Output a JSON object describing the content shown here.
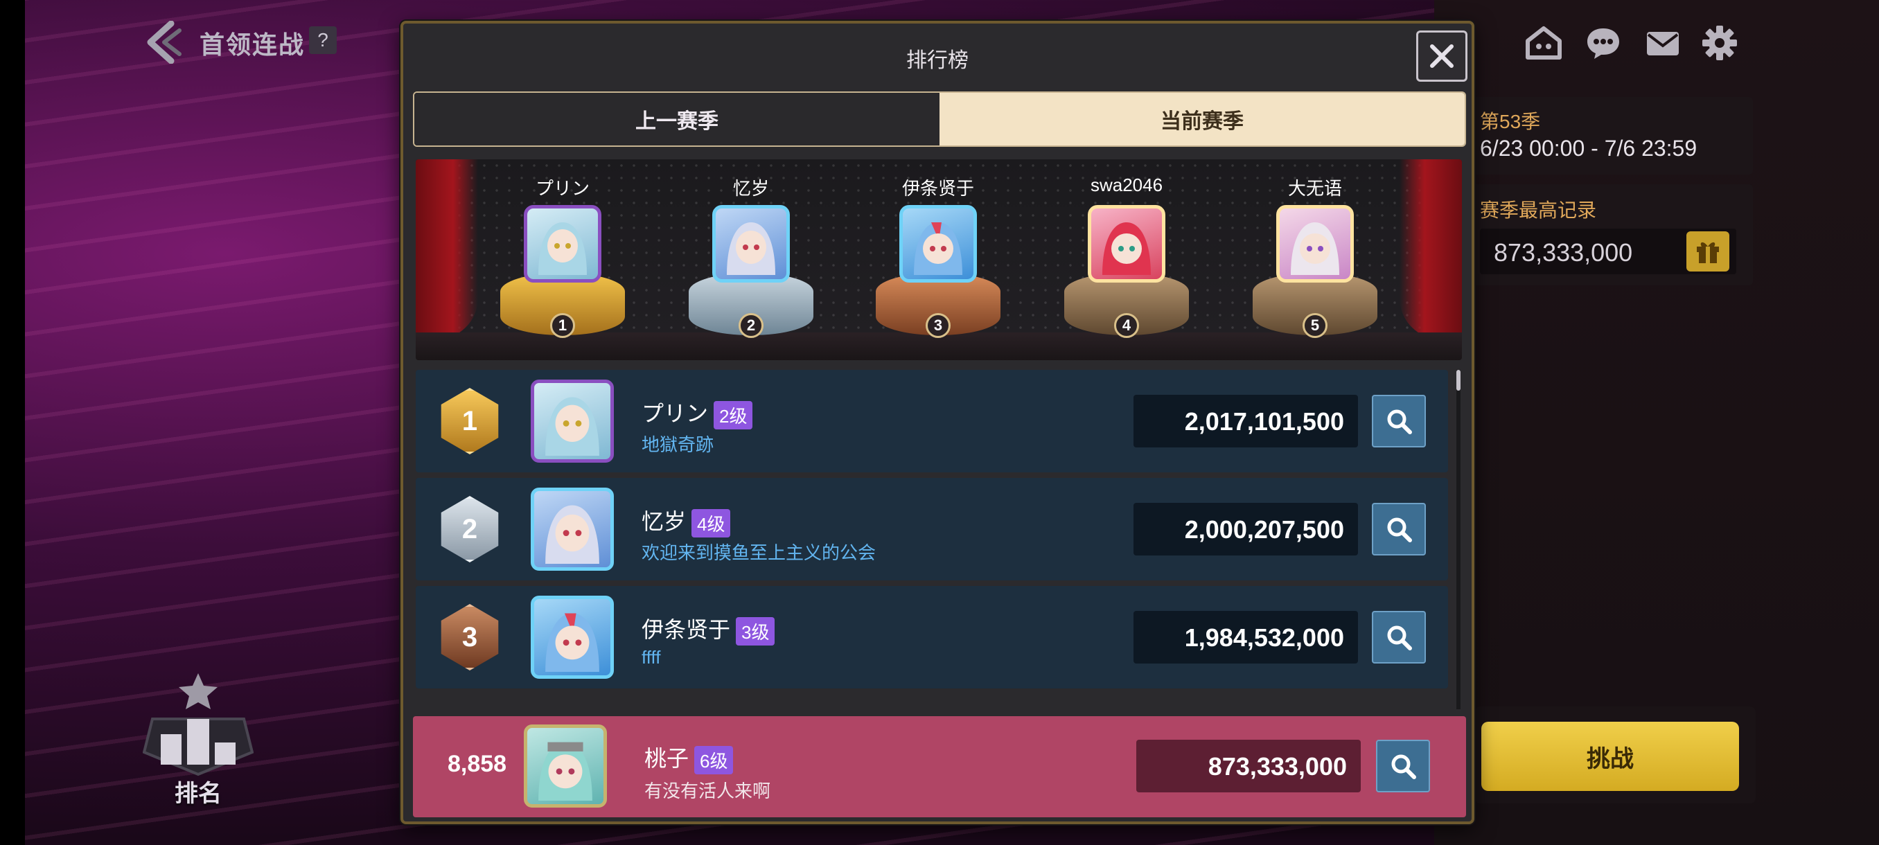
{
  "header": {
    "title": "首领连战",
    "help": "?"
  },
  "top_icons": [
    "guild-icon",
    "chat-icon",
    "mail-icon",
    "settings-icon"
  ],
  "season": {
    "label": "第53季",
    "range": "6/23 00:00 - 7/6 23:59"
  },
  "best_record": {
    "label": "赛季最高记录",
    "value": "873,333,000"
  },
  "challenge_button": "挑战",
  "rank_button": "排名",
  "modal": {
    "title": "排行榜",
    "tabs": [
      {
        "label": "上一赛季",
        "active": false
      },
      {
        "label": "当前赛季",
        "active": true
      }
    ],
    "podium": [
      {
        "rank": "1",
        "name": "プリン"
      },
      {
        "rank": "2",
        "name": "忆岁"
      },
      {
        "rank": "3",
        "name": "伊条贤于"
      },
      {
        "rank": "4",
        "name": "swa2046"
      },
      {
        "rank": "5",
        "name": "大无语"
      }
    ],
    "rows": [
      {
        "rank": "1",
        "name": "プリン",
        "level": "2级",
        "guild": "地獄奇跡",
        "score": "2,017,101,500"
      },
      {
        "rank": "2",
        "name": "忆岁",
        "level": "4级",
        "guild": "欢迎来到摸鱼至上主义的公会",
        "score": "2,000,207,500"
      },
      {
        "rank": "3",
        "name": "伊条贤于",
        "level": "3级",
        "guild": "ffff",
        "score": "1,984,532,000"
      }
    ],
    "my_row": {
      "rank": "8,858",
      "name": "桃子",
      "level": "6级",
      "guild": "有没有活人来啊",
      "score": "873,333,000"
    }
  },
  "colors": {
    "accent_gold": "#c8a02a",
    "active_tab": "#f3e3c5",
    "my_row": "#b04565",
    "level_badge": "#8e56e0",
    "guild_text": "#62b5f0"
  }
}
